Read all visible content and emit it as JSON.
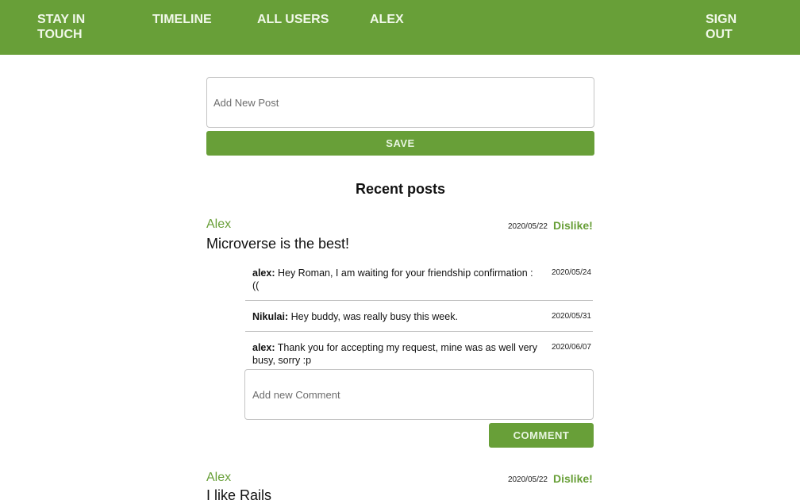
{
  "nav": {
    "brand": "STAY IN TOUCH",
    "timeline": "TIMELINE",
    "all_users": "ALL USERS",
    "user": "ALEX",
    "sign_out": "SIGN OUT"
  },
  "new_post": {
    "placeholder": "Add New Post",
    "save_label": "SAVE"
  },
  "recent_title": "Recent posts",
  "posts": [
    {
      "author": "Alex",
      "date": "2020/05/22",
      "dislike_label": "Dislike!",
      "body": "Microverse is the best!",
      "comments": [
        {
          "author": "alex:",
          "text": "Hey Roman, I am waiting for your friendship confirmation :((",
          "date": "2020/05/24"
        },
        {
          "author": "Nikulai:",
          "text": "Hey buddy, was really busy this week.",
          "date": "2020/05/31"
        },
        {
          "author": "alex:",
          "text": "Thank you for accepting my request, mine was as well very busy, sorry :p",
          "date": "2020/06/07"
        }
      ],
      "comment_placeholder": "Add new Comment",
      "comment_label": "COMMENT"
    },
    {
      "author": "Alex",
      "date": "2020/05/22",
      "dislike_label": "Dislike!",
      "body": "I like Rails"
    }
  ],
  "colors": {
    "accent": "#689f38"
  }
}
